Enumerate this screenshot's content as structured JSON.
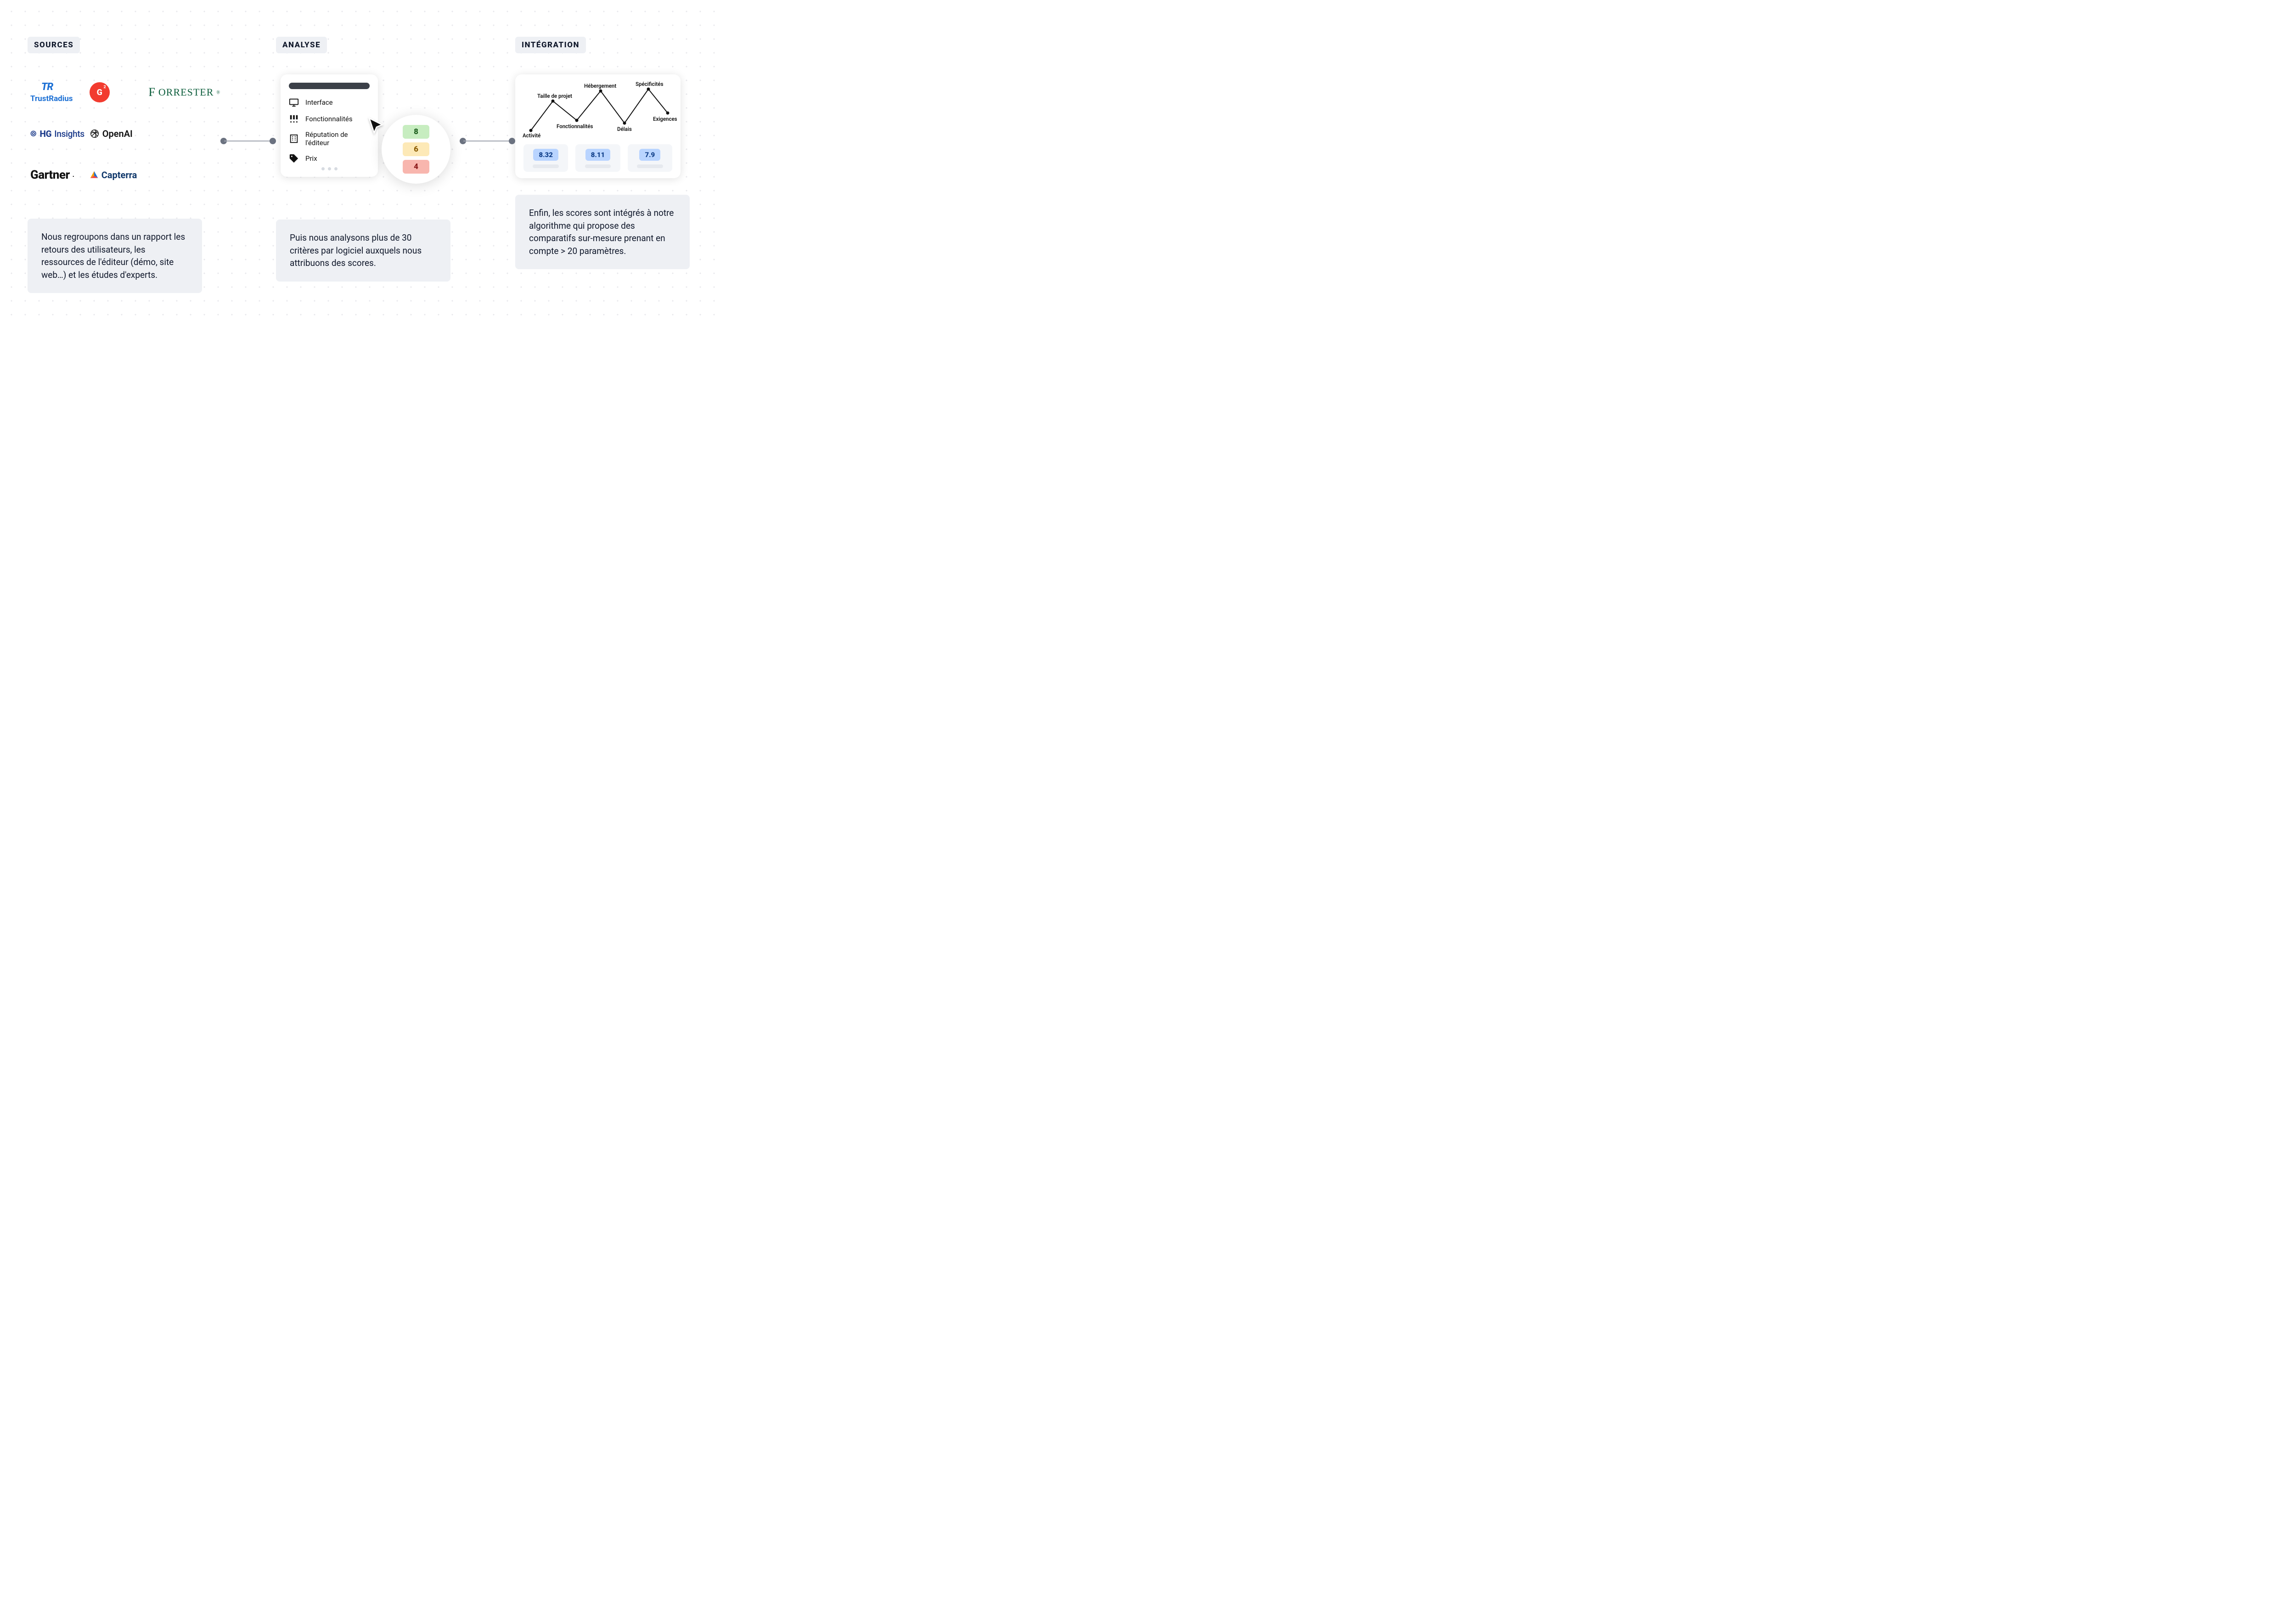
{
  "sources": {
    "tag": "SOURCES",
    "logos": {
      "trustradius": "TrustRadius",
      "forrester_pre": "F",
      "forrester_rest": "ORRESTER",
      "hg_pre": "HG",
      "hg_rest": "Insights",
      "openai": "OpenAI",
      "gartner": "Gartner",
      "capterra": "Capterra"
    },
    "description": "Nous regroupons dans un rapport les retours des utilisateurs, les ressources de l'éditeur (démo, site web…) et les études d'experts."
  },
  "analysis": {
    "tag": "ANALYSE",
    "criteria": {
      "interface": "Interface",
      "features": "Fonctionnalités",
      "reputation": "Réputation de l'éditeur",
      "price": "Prix"
    },
    "scores": {
      "high": "8",
      "mid": "6",
      "low": "4"
    },
    "description": "Puis nous analysons plus de 30 critères par logiciel auxquels nous attribuons des scores."
  },
  "integration": {
    "tag": "INTÉGRATION",
    "labels": {
      "activity": "Activité",
      "project_size": "Taille de projet",
      "features": "Fonctionnalités",
      "hosting": "Hébergement",
      "deadlines": "Délais",
      "specificities": "Spécificités",
      "requirements": "Exigences"
    },
    "results": {
      "a": "8.32",
      "b": "8.11",
      "c": "7.9"
    },
    "description": "Enfin, les scores sont intégrés à notre algorithme qui propose  des comparatifs sur-mesure prenant en compte > 20 paramètres."
  },
  "chart_data": {
    "type": "line",
    "categories": [
      "Activité",
      "Taille de projet",
      "Fonctionnalités",
      "Hébergement",
      "Délais",
      "Spécificités",
      "Exigences"
    ],
    "values": [
      0.05,
      0.65,
      0.3,
      0.85,
      0.25,
      0.9,
      0.45
    ],
    "title": "",
    "xlabel": "",
    "ylabel": "",
    "ylim": [
      0,
      1
    ]
  }
}
